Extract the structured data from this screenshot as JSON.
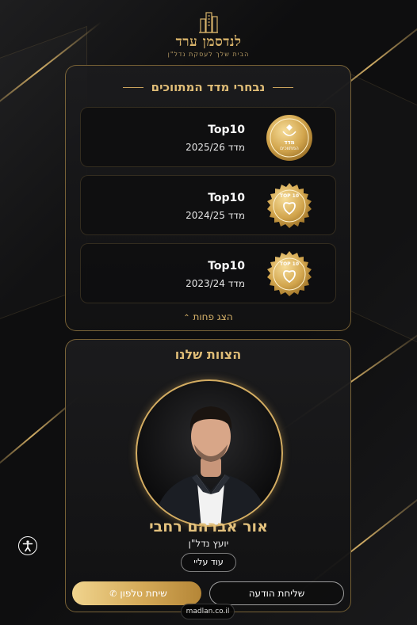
{
  "brand": {
    "name": "לנדסמן ערד",
    "tagline": "הבית שלך לעסקת נדל\"ן"
  },
  "awards": {
    "title": "נבחרי מדד המתווכים",
    "items": [
      {
        "title": "Top10",
        "subtitle": "מדד 2025/26",
        "badge_top": "מדד",
        "badge_mid": "המתווכים"
      },
      {
        "title": "Top10",
        "subtitle": "מדד 2024/25",
        "badge_top": "TOP 10"
      },
      {
        "title": "Top10",
        "subtitle": "מדד 2023/24",
        "badge_top": "TOP 10"
      }
    ],
    "show_less": "הצג פחות"
  },
  "team": {
    "title": "הצוות שלנו",
    "agent_name": "אור אברהם רחבי",
    "agent_role": "יועץ נדל\"ן",
    "more_label": "עוד עליי",
    "message_label": "שליחת הודעה",
    "call_label": "שיחת טלפון"
  },
  "footer": {
    "site": "madlan.co.il"
  },
  "colors": {
    "gold": "#d8b36a",
    "background": "#0e0e0f",
    "card_border": "#c9a25b"
  },
  "icons": [
    "building-logo-icon",
    "award-badge-icon",
    "chevron-up-icon",
    "phone-icon",
    "accessibility-icon"
  ]
}
